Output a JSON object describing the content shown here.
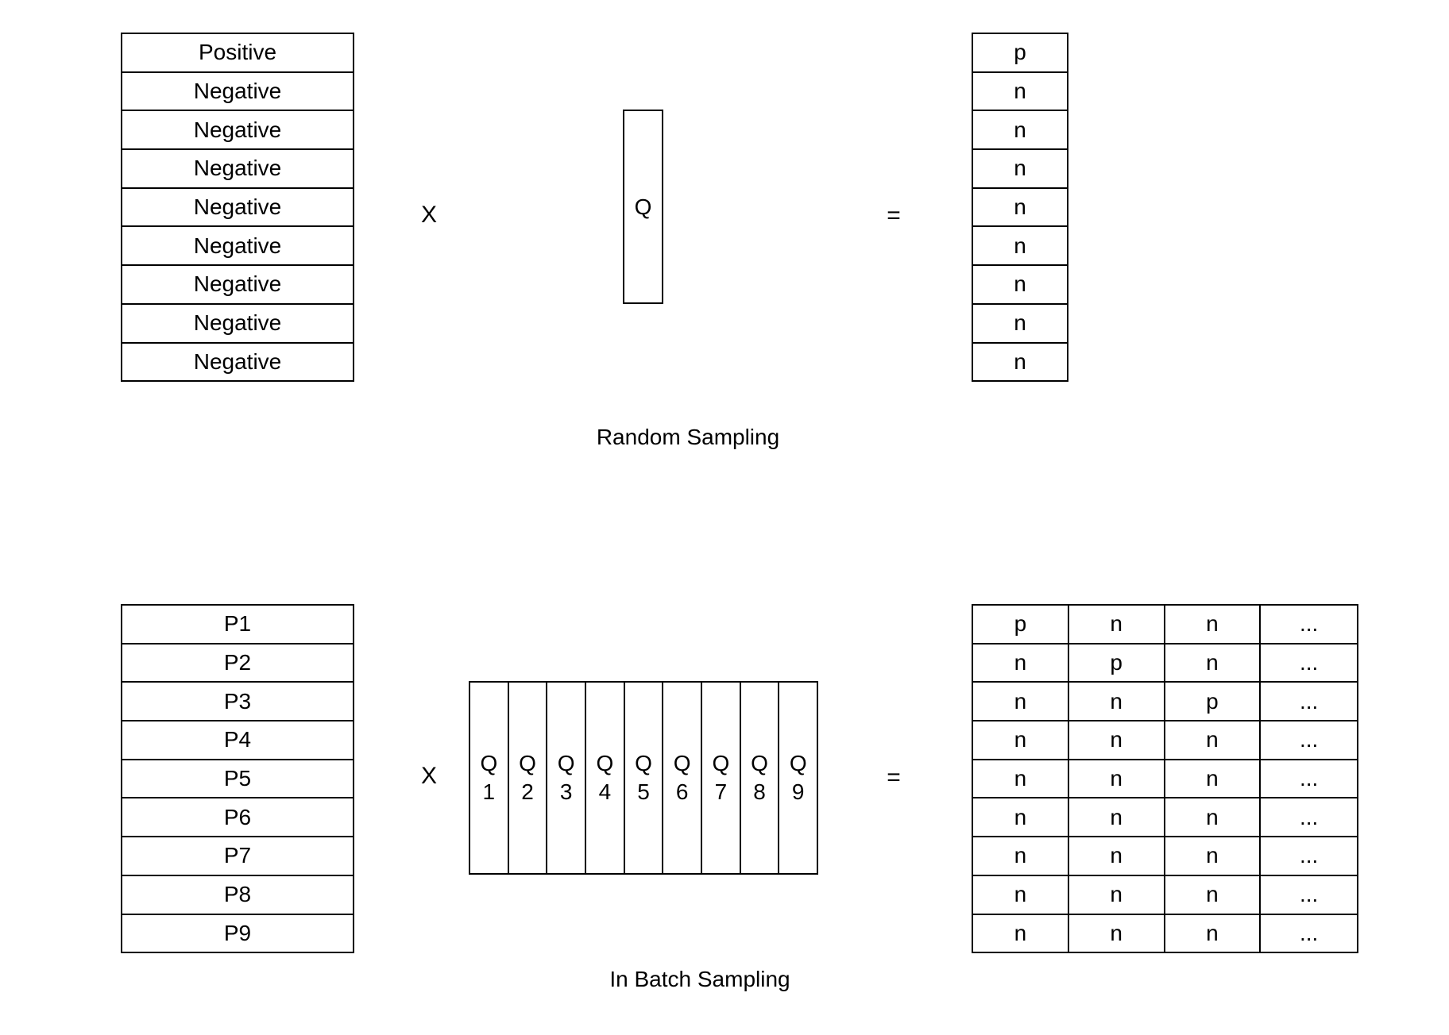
{
  "random_sampling": {
    "caption": "Random Sampling",
    "left_column": [
      "Positive",
      "Negative",
      "Negative",
      "Negative",
      "Negative",
      "Negative",
      "Negative",
      "Negative",
      "Negative"
    ],
    "operator_multiply": "X",
    "query": "Q",
    "operator_equals": "=",
    "result_column": [
      "p",
      "n",
      "n",
      "n",
      "n",
      "n",
      "n",
      "n",
      "n"
    ]
  },
  "in_batch_sampling": {
    "caption": "In Batch Sampling",
    "left_column": [
      "P1",
      "P2",
      "P3",
      "P4",
      "P5",
      "P6",
      "P7",
      "P8",
      "P9"
    ],
    "operator_multiply": "X",
    "queries": [
      {
        "letter": "Q",
        "index": "1"
      },
      {
        "letter": "Q",
        "index": "2"
      },
      {
        "letter": "Q",
        "index": "3"
      },
      {
        "letter": "Q",
        "index": "4"
      },
      {
        "letter": "Q",
        "index": "5"
      },
      {
        "letter": "Q",
        "index": "6"
      },
      {
        "letter": "Q",
        "index": "7"
      },
      {
        "letter": "Q",
        "index": "8"
      },
      {
        "letter": "Q",
        "index": "9"
      }
    ],
    "operator_equals": "=",
    "result_matrix": [
      [
        "p",
        "n",
        "n",
        "..."
      ],
      [
        "n",
        "p",
        "n",
        "..."
      ],
      [
        "n",
        "n",
        "p",
        "..."
      ],
      [
        "n",
        "n",
        "n",
        "..."
      ],
      [
        "n",
        "n",
        "n",
        "..."
      ],
      [
        "n",
        "n",
        "n",
        "..."
      ],
      [
        "n",
        "n",
        "n",
        "..."
      ],
      [
        "n",
        "n",
        "n",
        "..."
      ],
      [
        "n",
        "n",
        "n",
        "..."
      ]
    ]
  }
}
